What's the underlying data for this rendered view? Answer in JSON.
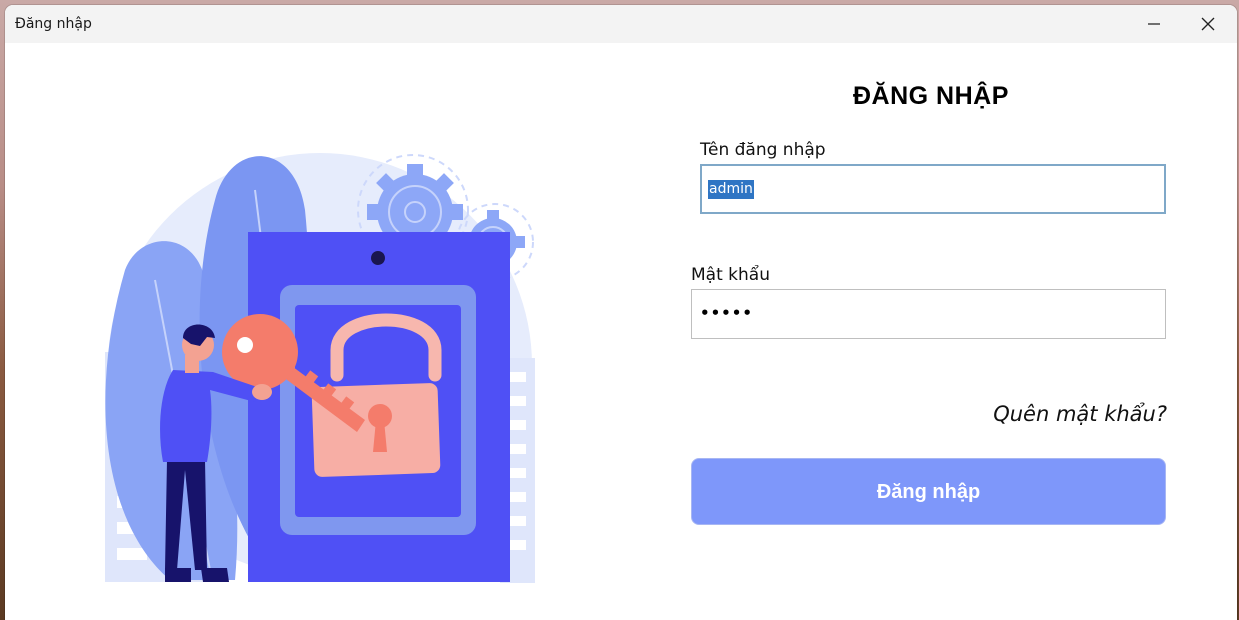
{
  "window": {
    "title": "Đăng nhập"
  },
  "form": {
    "heading": "ĐĂNG NHẬP",
    "username_label": "Tên đăng nhập",
    "username_value": "admin",
    "password_label": "Mật khẩu",
    "password_value": "•••••",
    "forgot_link": "Quên mật khẩu?",
    "submit_label": "Đăng nhập"
  },
  "colors": {
    "button_bg": "#7e97fa",
    "selection": "#2f75c4",
    "illustration_primary": "#5052f5",
    "illustration_key": "#f47c6b"
  },
  "icons": [
    "minimize-icon",
    "close-icon",
    "lock-key-illustration"
  ]
}
